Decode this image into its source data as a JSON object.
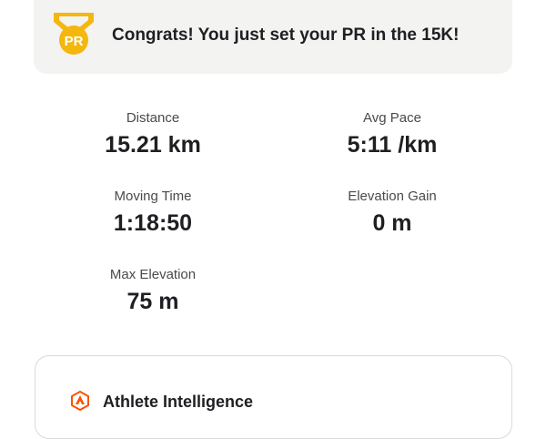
{
  "pr_banner": {
    "medal_icon": "pr-medal-icon",
    "medal_text": "PR",
    "message": "Congrats! You just set your PR in the 15K!"
  },
  "stats": {
    "distance": {
      "label": "Distance",
      "value": "15.21 km"
    },
    "avg_pace": {
      "label": "Avg Pace",
      "value": "5:11 /km"
    },
    "moving_time": {
      "label": "Moving Time",
      "value": "1:18:50"
    },
    "elevation_gain": {
      "label": "Elevation Gain",
      "value": "0 m"
    },
    "max_elevation": {
      "label": "Max Elevation",
      "value": "75 m"
    }
  },
  "athlete_intelligence": {
    "icon": "athlete-intelligence-icon",
    "title": "Athlete Intelligence"
  },
  "colors": {
    "medal_gold": "#f5b70e",
    "banner_bg": "#f3f3f2",
    "brand_orange": "#fc5200"
  }
}
